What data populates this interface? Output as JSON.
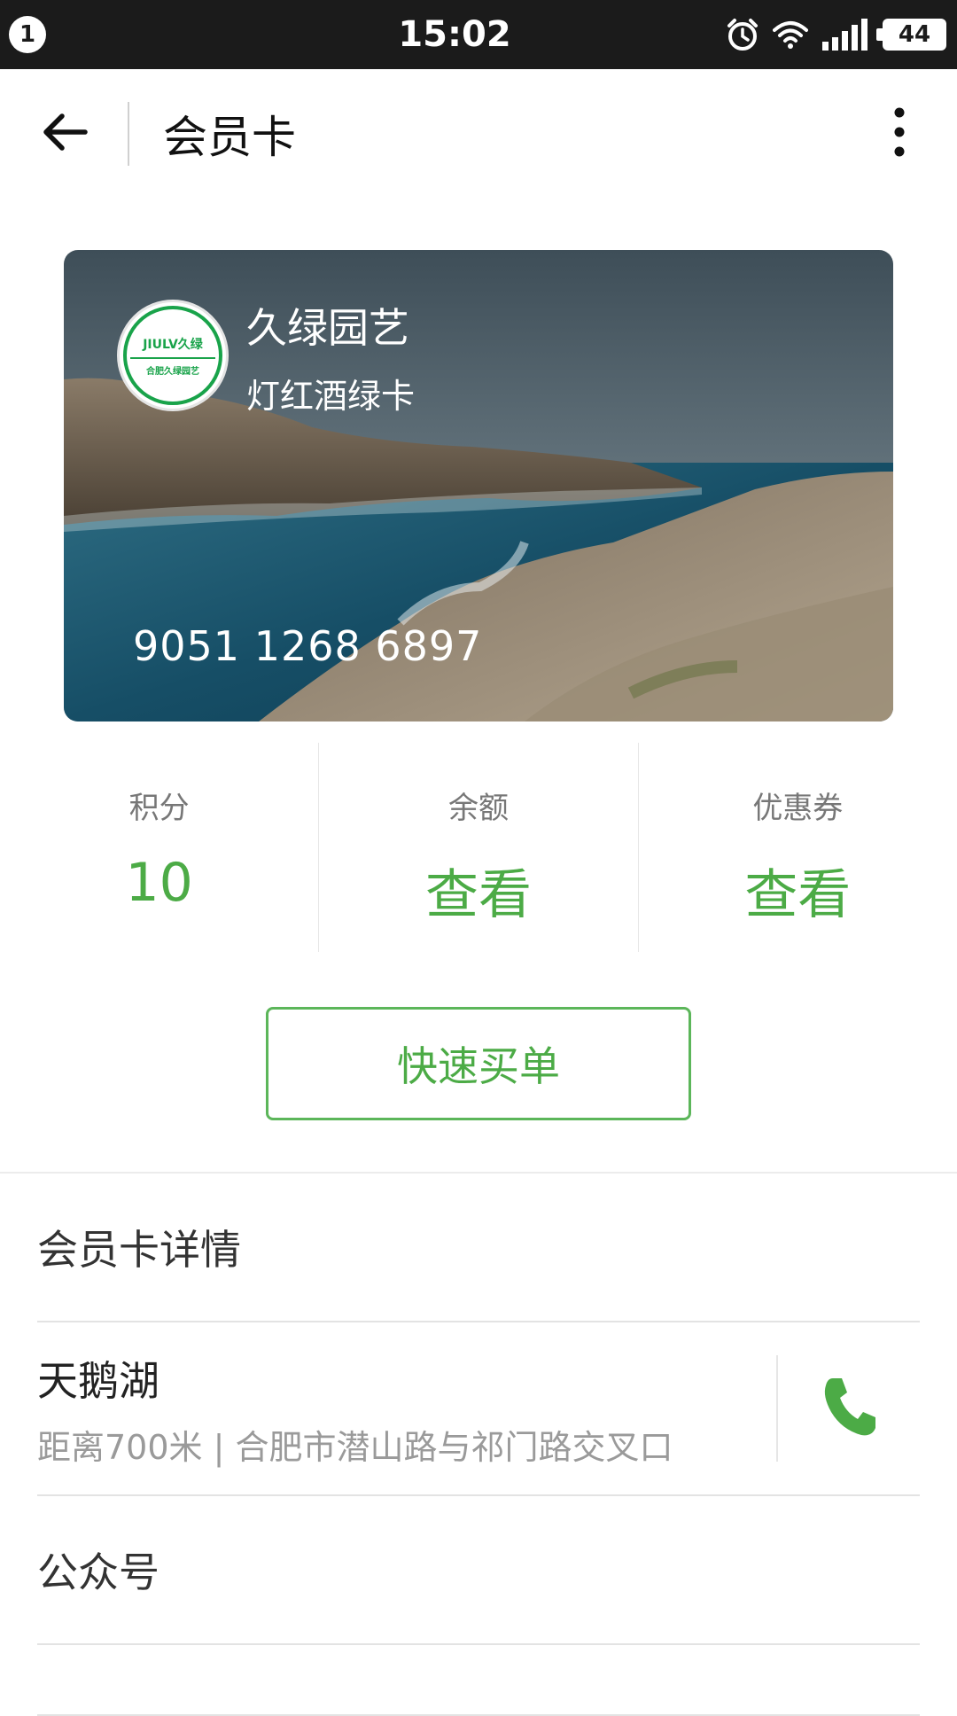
{
  "status_bar": {
    "notification_count": "1",
    "time": "15:02",
    "battery": "44",
    "icons": [
      "alarm-icon",
      "wifi-icon",
      "signal-icon",
      "battery-icon"
    ]
  },
  "header": {
    "title": "会员卡",
    "back_icon": "arrow-left-icon",
    "more_icon": "more-vertical-icon"
  },
  "card": {
    "shop_name": "久绿园艺",
    "card_name": "灯红酒绿卡",
    "number": "9051 1268 6897",
    "logo_top": "JIULV久绿",
    "logo_bottom": "合肥久绿园艺"
  },
  "stats": [
    {
      "label": "积分",
      "value": "10"
    },
    {
      "label": "余额",
      "value": "查看"
    },
    {
      "label": "优惠券",
      "value": "查看"
    }
  ],
  "quick_pay_label": "快速买单",
  "list": {
    "details": "会员卡详情",
    "store": {
      "name": "天鹅湖",
      "address": "距离700米 | 合肥市潜山路与祁门路交叉口"
    },
    "official_account": "公众号"
  },
  "colors": {
    "accent": "#4cab46",
    "status_bar": "#1b1b1b"
  }
}
